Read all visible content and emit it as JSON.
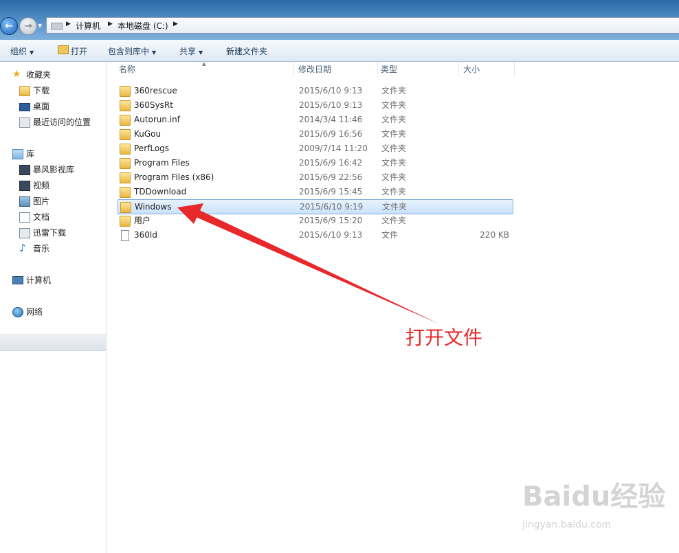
{
  "address": {
    "crumbs": [
      "计算机",
      "本地磁盘 (C:)"
    ]
  },
  "toolbar": {
    "organize": "组织",
    "open": "打开",
    "include_in_library": "包含到库中",
    "share": "共享",
    "new_folder": "新建文件夹"
  },
  "nav": {
    "favorites": "收藏夹",
    "downloads": "下载",
    "desktop": "桌面",
    "recent": "最近访问的位置",
    "libraries": "库",
    "storm": "暴风影视库",
    "videos": "视频",
    "pictures": "图片",
    "documents": "文档",
    "xunlei": "迅雷下载",
    "music": "音乐",
    "computer": "计算机",
    "network": "网络"
  },
  "columns": {
    "name": "名称",
    "modified": "修改日期",
    "type": "类型",
    "size": "大小"
  },
  "files": [
    {
      "name": "360rescue",
      "date": "2015/6/10 9:13",
      "type": "文件夹",
      "size": ""
    },
    {
      "name": "360SysRt",
      "date": "2015/6/10 9:13",
      "type": "文件夹",
      "size": ""
    },
    {
      "name": "Autorun.inf",
      "date": "2014/3/4 11:46",
      "type": "文件夹",
      "size": ""
    },
    {
      "name": "KuGou",
      "date": "2015/6/9 16:56",
      "type": "文件夹",
      "size": ""
    },
    {
      "name": "PerfLogs",
      "date": "2009/7/14 11:20",
      "type": "文件夹",
      "size": ""
    },
    {
      "name": "Program Files",
      "date": "2015/6/9 16:42",
      "type": "文件夹",
      "size": ""
    },
    {
      "name": "Program Files (x86)",
      "date": "2015/6/9 22:56",
      "type": "文件夹",
      "size": ""
    },
    {
      "name": "TDDownload",
      "date": "2015/6/9 15:45",
      "type": "文件夹",
      "size": ""
    },
    {
      "name": "Windows",
      "date": "2015/6/10 9:19",
      "type": "文件夹",
      "size": ""
    },
    {
      "name": "用户",
      "date": "2015/6/9 15:20",
      "type": "文件夹",
      "size": ""
    },
    {
      "name": "360ld",
      "date": "2015/6/10 9:13",
      "type": "文件",
      "size": "220 KB"
    }
  ],
  "annotation": "打开文件",
  "watermark": {
    "logo": "Baidu经验",
    "url": "jingyan.baidu.com"
  },
  "colors": {
    "annotation": "#e8292b",
    "selection": "#c9e2fb"
  }
}
